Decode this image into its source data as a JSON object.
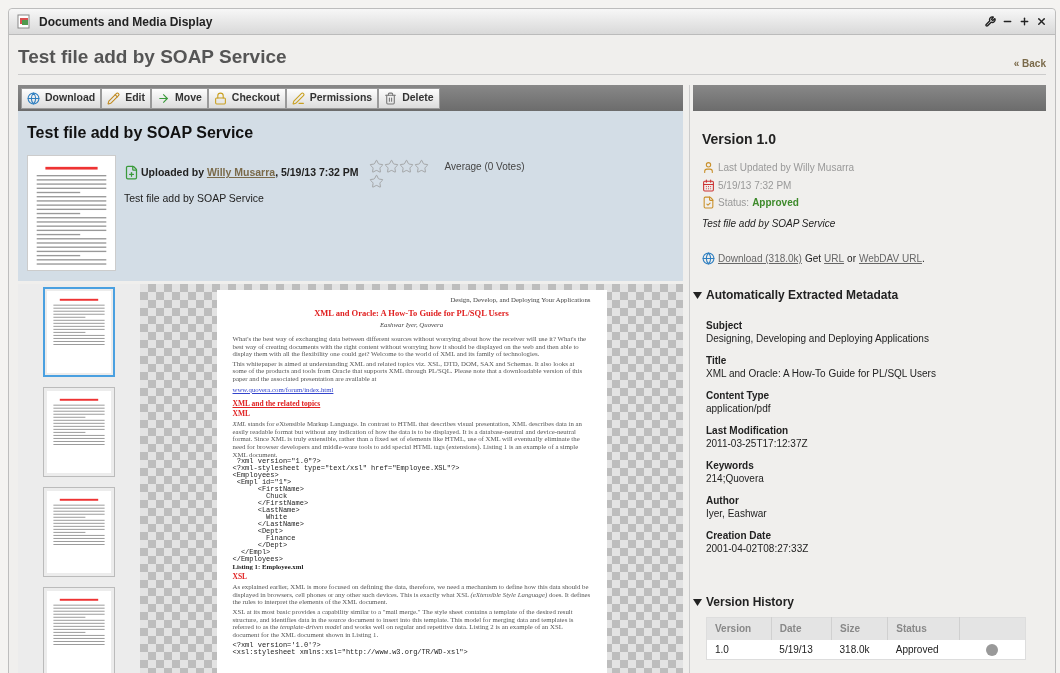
{
  "window": {
    "title": "Documents and Media Display"
  },
  "page": {
    "title": "Test file add by SOAP Service",
    "back": "« Back"
  },
  "toolbar": [
    {
      "label": "Download"
    },
    {
      "label": "Edit"
    },
    {
      "label": "Move"
    },
    {
      "label": "Checkout"
    },
    {
      "label": "Permissions"
    },
    {
      "label": "Delete"
    }
  ],
  "file": {
    "title": "Test file add by SOAP Service",
    "uploaded_prefix": "Uploaded by",
    "uploader": "Willy Musarra",
    "uploaded_date": ", 5/19/13 7:32 PM",
    "description": "Test file add by SOAP Service"
  },
  "rating": {
    "stars": 0,
    "average": "Average (0 Votes)"
  },
  "thumbnails": [
    {
      "selected": true
    },
    {
      "selected": false
    },
    {
      "selected": false
    },
    {
      "selected": false
    }
  ],
  "document": [
    {
      "kind": "header",
      "text": "Design, Develop, and Deploying Your Applications"
    },
    {
      "kind": "title",
      "text": "XML and Oracle: A How-To Guide for PL/SQL Users"
    },
    {
      "kind": "author",
      "text": "Eashwar Iyer, Quovera"
    },
    {
      "kind": "para",
      "text": "What's the best way of exchanging data between different sources without worrying about how the receiver will use it? What's the best way of creating documents with the right content without worrying how it should be displayed on the web and then able to display them with all the flexibility one could get? Welcome to the world of XML and its family of technologies."
    },
    {
      "kind": "para",
      "text": "This whitepaper is aimed at understanding XML and related topics viz. XSL, DTD, DOM, SAX and Schemas. It also looks at some of the products and tools from Oracle that supports XML through PL/SQL. Please note that a downloadable version of this paper and the associated presentation are available at"
    },
    {
      "kind": "link",
      "text": "www.quovera.com/forum/index.html"
    },
    {
      "kind": "heading",
      "text": "XML and the related topics"
    },
    {
      "kind": "subheading",
      "text": "XML"
    },
    {
      "kind": "para",
      "text": "*XML* stands for eXtensible Markup Language. In contrast to HTML that describes visual presentation, XML describes data in an easily readable format but without any indication of how the data is to be displayed. It is a database-neutral and device-neutral format. Since XML is truly extensible, rather than a fixed set of elements like HTML, use of XML will eventually eliminate the need for browser developers and middle-ware tools to add special HTML tags (extensions).  Listing 1 is an example of a simple XML document."
    },
    {
      "kind": "code",
      "text": " ?xml version=\"1.0\"?>"
    },
    {
      "kind": "code",
      "text": "<?xml-stylesheet type=\"text/xsl\" href=\"Employee.XSL\"?>"
    },
    {
      "kind": "code",
      "text": "<Employees>"
    },
    {
      "kind": "code",
      "text": " <Empl id=\"1\">"
    },
    {
      "kind": "code",
      "text": "      <FirstName>"
    },
    {
      "kind": "code",
      "text": "        Chuck"
    },
    {
      "kind": "code",
      "text": "      </FirstName>"
    },
    {
      "kind": "code",
      "text": "      <LastName>"
    },
    {
      "kind": "code",
      "text": "        White"
    },
    {
      "kind": "code",
      "text": "      </LastName>"
    },
    {
      "kind": "code",
      "text": "      <Dept>"
    },
    {
      "kind": "code",
      "text": "        Finance"
    },
    {
      "kind": "code",
      "text": "      </Dept>"
    },
    {
      "kind": "code",
      "text": "  </Empl>"
    },
    {
      "kind": "code",
      "text": "</Employees>"
    },
    {
      "kind": "caption",
      "text": "Listing 1: Employee.xml"
    },
    {
      "kind": "subheading",
      "text": "XSL"
    },
    {
      "kind": "para",
      "text": "As explained earlier, XML is more focused on defining the data, therefore, we need a mechanism to define how this data should be displayed in browsers, cell phones or any other such devices. This is exactly what XSL *(eXtensible Style Language)* does. It defines the rules to interpret the elements of the XML document."
    },
    {
      "kind": "para",
      "text": "XSL at its most basic provides a capability similar to a \"mail merge.\" The style sheet contains a template of the desired result structure, and identifies data in the source document to insert into this template. This model for merging data and templates is referred to as the *template-driven model* and works well on regular and repetitive data. Listing 2 is an example of an XSL document for the XML document shown in Listing 1."
    },
    {
      "kind": "spacer"
    },
    {
      "kind": "code",
      "text": "<?xml version='1.0'?>"
    },
    {
      "kind": "code",
      "text": "<xsl:stylesheet xmlns:xsl=\"http://www.w3.org/TR/WD-xsl\">"
    }
  ],
  "version": {
    "title": "Version 1.0",
    "updated": "Last Updated by Willy Musarra",
    "date": "5/19/13 7:32 PM",
    "status_label": "Status:",
    "status": "Approved",
    "description": "Test file add by SOAP Service",
    "download": "Download (318.0k)",
    "get": "Get",
    "url": "URL",
    "or": "or",
    "webdav": "WebDAV URL",
    "period": "."
  },
  "metadata": {
    "title": "Automatically Extracted Metadata",
    "expanded": true,
    "items": [
      {
        "label": "Subject",
        "value": "Designing, Developing and Deploying Applications"
      },
      {
        "label": "Title",
        "value": "XML and Oracle: A How-To Guide for PL/SQL Users"
      },
      {
        "label": "Content Type",
        "value": "application/pdf"
      },
      {
        "label": "Last Modification",
        "value": "2011-03-25T17:12:37Z"
      },
      {
        "label": "Keywords",
        "value": "214;Quovera"
      },
      {
        "label": "Author",
        "value": "Iyer, Eashwar"
      },
      {
        "label": "Creation Date",
        "value": "2001-04-02T08:27:33Z"
      }
    ]
  },
  "version_history": {
    "title": "Version History",
    "expanded": true,
    "columns": [
      "Version",
      "Date",
      "Size",
      "Status"
    ],
    "rows": [
      {
        "version": "1.0",
        "date": "5/19/13",
        "size": "318.0k",
        "status": "Approved"
      }
    ]
  }
}
